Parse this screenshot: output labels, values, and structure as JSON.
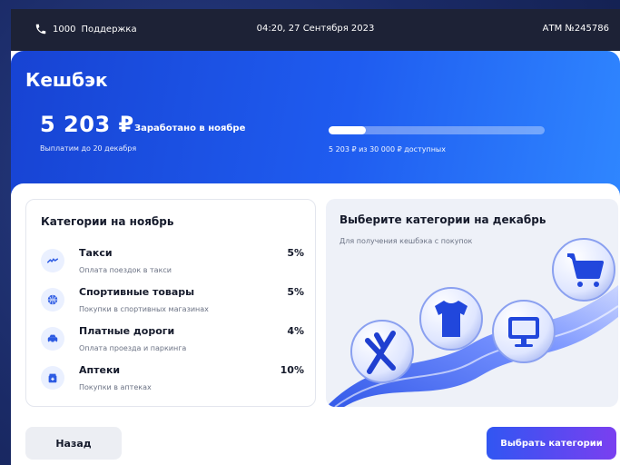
{
  "statusbar": {
    "phone_number": "1000",
    "support_label": "Поддержка",
    "datetime": "04:20, 27 Сентября 2023",
    "atm_id": "АТМ №245786"
  },
  "cashback": {
    "title": "Кешбэк",
    "amount": "5 203 ₽",
    "earned_label": "Заработано в ноябре",
    "payout_note": "Выплатим до 20 декабря",
    "progress_fraction": 0.173,
    "progress_label": "5 203 ₽ из 30 000 ₽ доступных"
  },
  "categories_card": {
    "title": "Категории на ноябрь",
    "items": [
      {
        "name": "Такси",
        "description": "Оплата поездок в такси",
        "percent": "5%",
        "icon": "taxi-icon"
      },
      {
        "name": "Спортивные товары",
        "description": "Покупки в спортивных магазинах",
        "percent": "5%",
        "icon": "ball-icon"
      },
      {
        "name": "Платные дороги",
        "description": "Оплата проезда и паркинга",
        "percent": "4%",
        "icon": "car-icon"
      },
      {
        "name": "Аптеки",
        "description": "Покупки в аптеках",
        "percent": "10%",
        "icon": "medicine-icon"
      }
    ]
  },
  "promo_card": {
    "title": "Выберите категории на декабрь",
    "subtitle": "Для получения кешбэка с покупок",
    "art_icons": [
      "cart-icon",
      "tshirt-icon",
      "monitor-icon",
      "cutlery-icon"
    ]
  },
  "buttons": {
    "back_label": "Назад",
    "select_label": "Выбрать категории"
  },
  "colors": {
    "accent": "#1f5cf0",
    "statusbar_bg": "#1d2236",
    "button_gradient_start": "#3156f2",
    "button_gradient_end": "#7a3ff0"
  }
}
